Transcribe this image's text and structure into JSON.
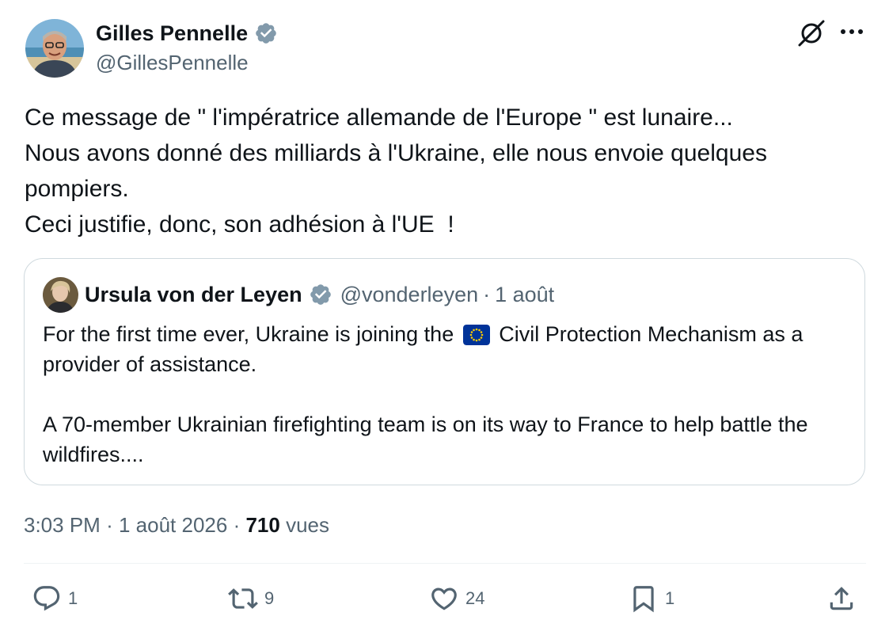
{
  "author": {
    "name": "Gilles Pennelle",
    "handle": "@GillesPennelle"
  },
  "body": {
    "lines": [
      "Ce message de \" l'impératrice allemande de l'Europe \" est lunaire...",
      "Nous avons donné des milliards à l'Ukraine, elle nous envoie quelques pompiers.",
      "Ceci justifie, donc, son adhésion à l'UE  !"
    ]
  },
  "quote": {
    "name": "Ursula von der Leyen",
    "handle": "@vonderleyen",
    "separator": "·",
    "date": "1 août",
    "text_before_flag": "For the first time ever, Ukraine is joining the",
    "flag_icon": "eu-flag-icon",
    "text_after_flag": "Civil Protection Mechanism as a provider of assistance.",
    "paragraph2": "A 70-member Ukrainian firefighting team is on its way to France to help battle the wildfires...."
  },
  "meta": {
    "time": "3:03 PM",
    "sep1": "·",
    "date": "1 août 2026",
    "sep2": "·",
    "views_count": "710",
    "views_label": "vues"
  },
  "actions": {
    "reply_count": "1",
    "retweet_count": "9",
    "like_count": "24",
    "bookmark_count": "1"
  },
  "icons": {
    "verified": "verified-badge-icon",
    "grok": "grok-icon",
    "more": "more-dots-icon",
    "reply": "reply-icon",
    "retweet": "retweet-icon",
    "like": "heart-icon",
    "bookmark": "bookmark-icon",
    "share": "share-icon"
  },
  "colors": {
    "text": "#0f1419",
    "secondary": "#536471",
    "border": "#cfd9de",
    "verified": "#829aab",
    "eu_blue": "#003399",
    "eu_gold": "#ffcc00"
  }
}
